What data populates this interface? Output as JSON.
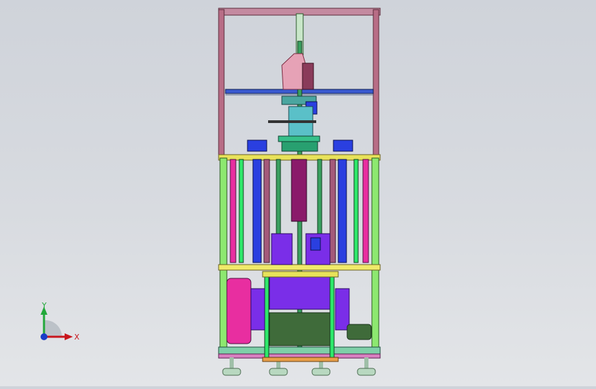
{
  "viewport": {
    "background_top": "#cfd3da",
    "background_bottom": "#e3e5e8"
  },
  "model": {
    "frame_color": "#c8809a",
    "rail_color": "#2ee86a",
    "beam_color": "#e8e25a",
    "blue_part_color": "#2a3fe0",
    "purple_panel_color": "#7a2ee8",
    "magenta_panel_color": "#e82ea0",
    "dark_green_color": "#3f6b3a"
  },
  "triad": {
    "x_label": "X",
    "y_label": "Y",
    "x_color": "#c8161d",
    "y_color": "#22a83a",
    "origin_color": "#1a3cc8"
  }
}
